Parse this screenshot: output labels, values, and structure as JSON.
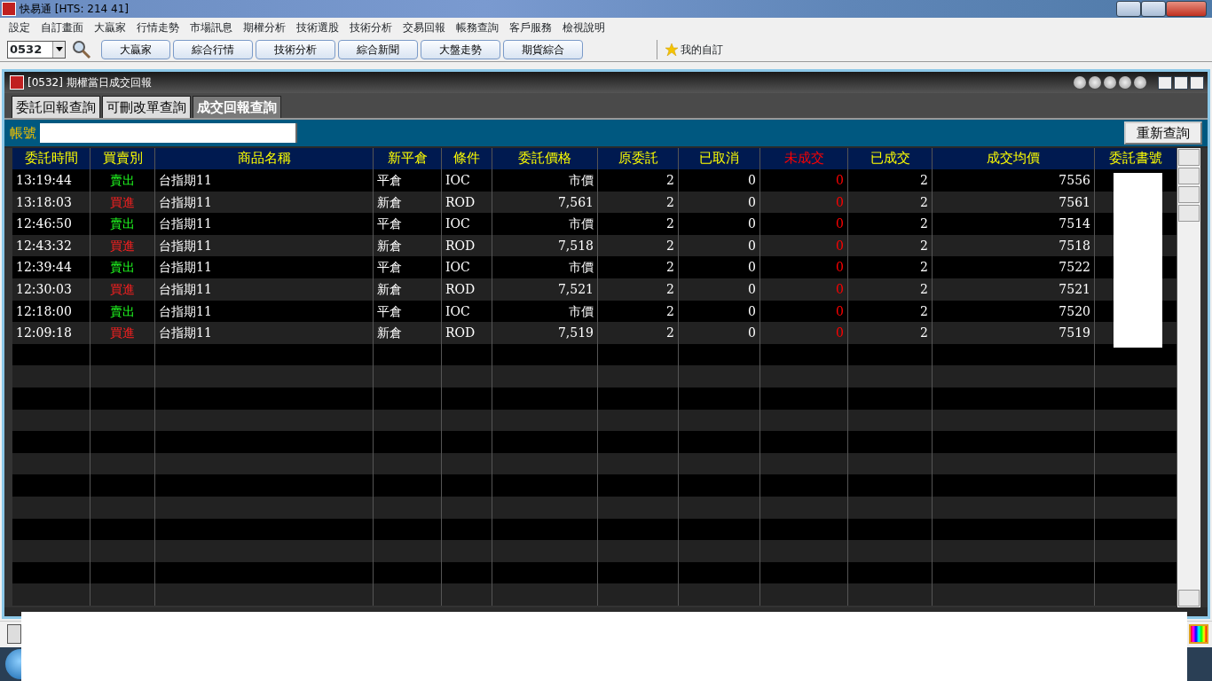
{
  "window": {
    "title": "快易通  [HTS: 214 41]"
  },
  "menu": [
    "設定",
    "自訂畫面",
    "大贏家",
    "行情走勢",
    "市場訊息",
    "期權分析",
    "技術選股",
    "技術分析",
    "交易回報",
    "帳務查詢",
    "客戶服務",
    "檢視說明"
  ],
  "toolbar": {
    "code": "0532",
    "buttons": [
      "大贏家",
      "綜合行情",
      "技術分析",
      "綜合新聞",
      "大盤走勢",
      "期貨綜合"
    ],
    "favorite": "我的自訂"
  },
  "subwindow": {
    "title": "[0532] 期權當日成交回報",
    "tabs": [
      {
        "label": "委託回報查詢",
        "selected": false
      },
      {
        "label": "可刪改單查詢",
        "selected": false
      },
      {
        "label": "成交回報查詢",
        "selected": true
      }
    ],
    "account_label": "帳號",
    "requery_button": "重新查詢",
    "table": {
      "columns": [
        {
          "label": "委託時間",
          "highlighted": false
        },
        {
          "label": "買賣別",
          "highlighted": false
        },
        {
          "label": "商品名稱",
          "highlighted": false
        },
        {
          "label": "新平倉",
          "highlighted": false
        },
        {
          "label": "條件",
          "highlighted": false
        },
        {
          "label": "委託價格",
          "highlighted": false
        },
        {
          "label": "原委託",
          "highlighted": false
        },
        {
          "label": "已取消",
          "highlighted": false
        },
        {
          "label": "未成交",
          "highlighted": true
        },
        {
          "label": "已成交",
          "highlighted": false
        },
        {
          "label": "成交均價",
          "highlighted": false
        },
        {
          "label": "委託書號",
          "highlighted": false
        }
      ],
      "rows": [
        {
          "kind": "sell",
          "cells": [
            "13:19:44",
            "賣出",
            "台指期11",
            "平倉",
            "IOC",
            "市價",
            "2",
            "0",
            "0",
            "2",
            "7556"
          ]
        },
        {
          "kind": "buy",
          "cells": [
            "13:18:03",
            "買進",
            "台指期11",
            "新倉",
            "ROD",
            "7,561",
            "2",
            "0",
            "0",
            "2",
            "7561"
          ]
        },
        {
          "kind": "sell",
          "cells": [
            "12:46:50",
            "賣出",
            "台指期11",
            "平倉",
            "IOC",
            "市價",
            "2",
            "0",
            "0",
            "2",
            "7514"
          ]
        },
        {
          "kind": "buy",
          "cells": [
            "12:43:32",
            "買進",
            "台指期11",
            "新倉",
            "ROD",
            "7,518",
            "2",
            "0",
            "0",
            "2",
            "7518"
          ]
        },
        {
          "kind": "sell",
          "cells": [
            "12:39:44",
            "賣出",
            "台指期11",
            "平倉",
            "IOC",
            "市價",
            "2",
            "0",
            "0",
            "2",
            "7522"
          ]
        },
        {
          "kind": "buy",
          "cells": [
            "12:30:03",
            "買進",
            "台指期11",
            "新倉",
            "ROD",
            "7,521",
            "2",
            "0",
            "0",
            "2",
            "7521"
          ]
        },
        {
          "kind": "sell",
          "cells": [
            "12:18:00",
            "賣出",
            "台指期11",
            "平倉",
            "IOC",
            "市價",
            "2",
            "0",
            "0",
            "2",
            "7520"
          ]
        },
        {
          "kind": "buy",
          "cells": [
            "12:09:18",
            "買進",
            "台指期11",
            "新倉",
            "ROD",
            "7,519",
            "2",
            "0",
            "0",
            "2",
            "7519"
          ]
        }
      ]
    }
  }
}
